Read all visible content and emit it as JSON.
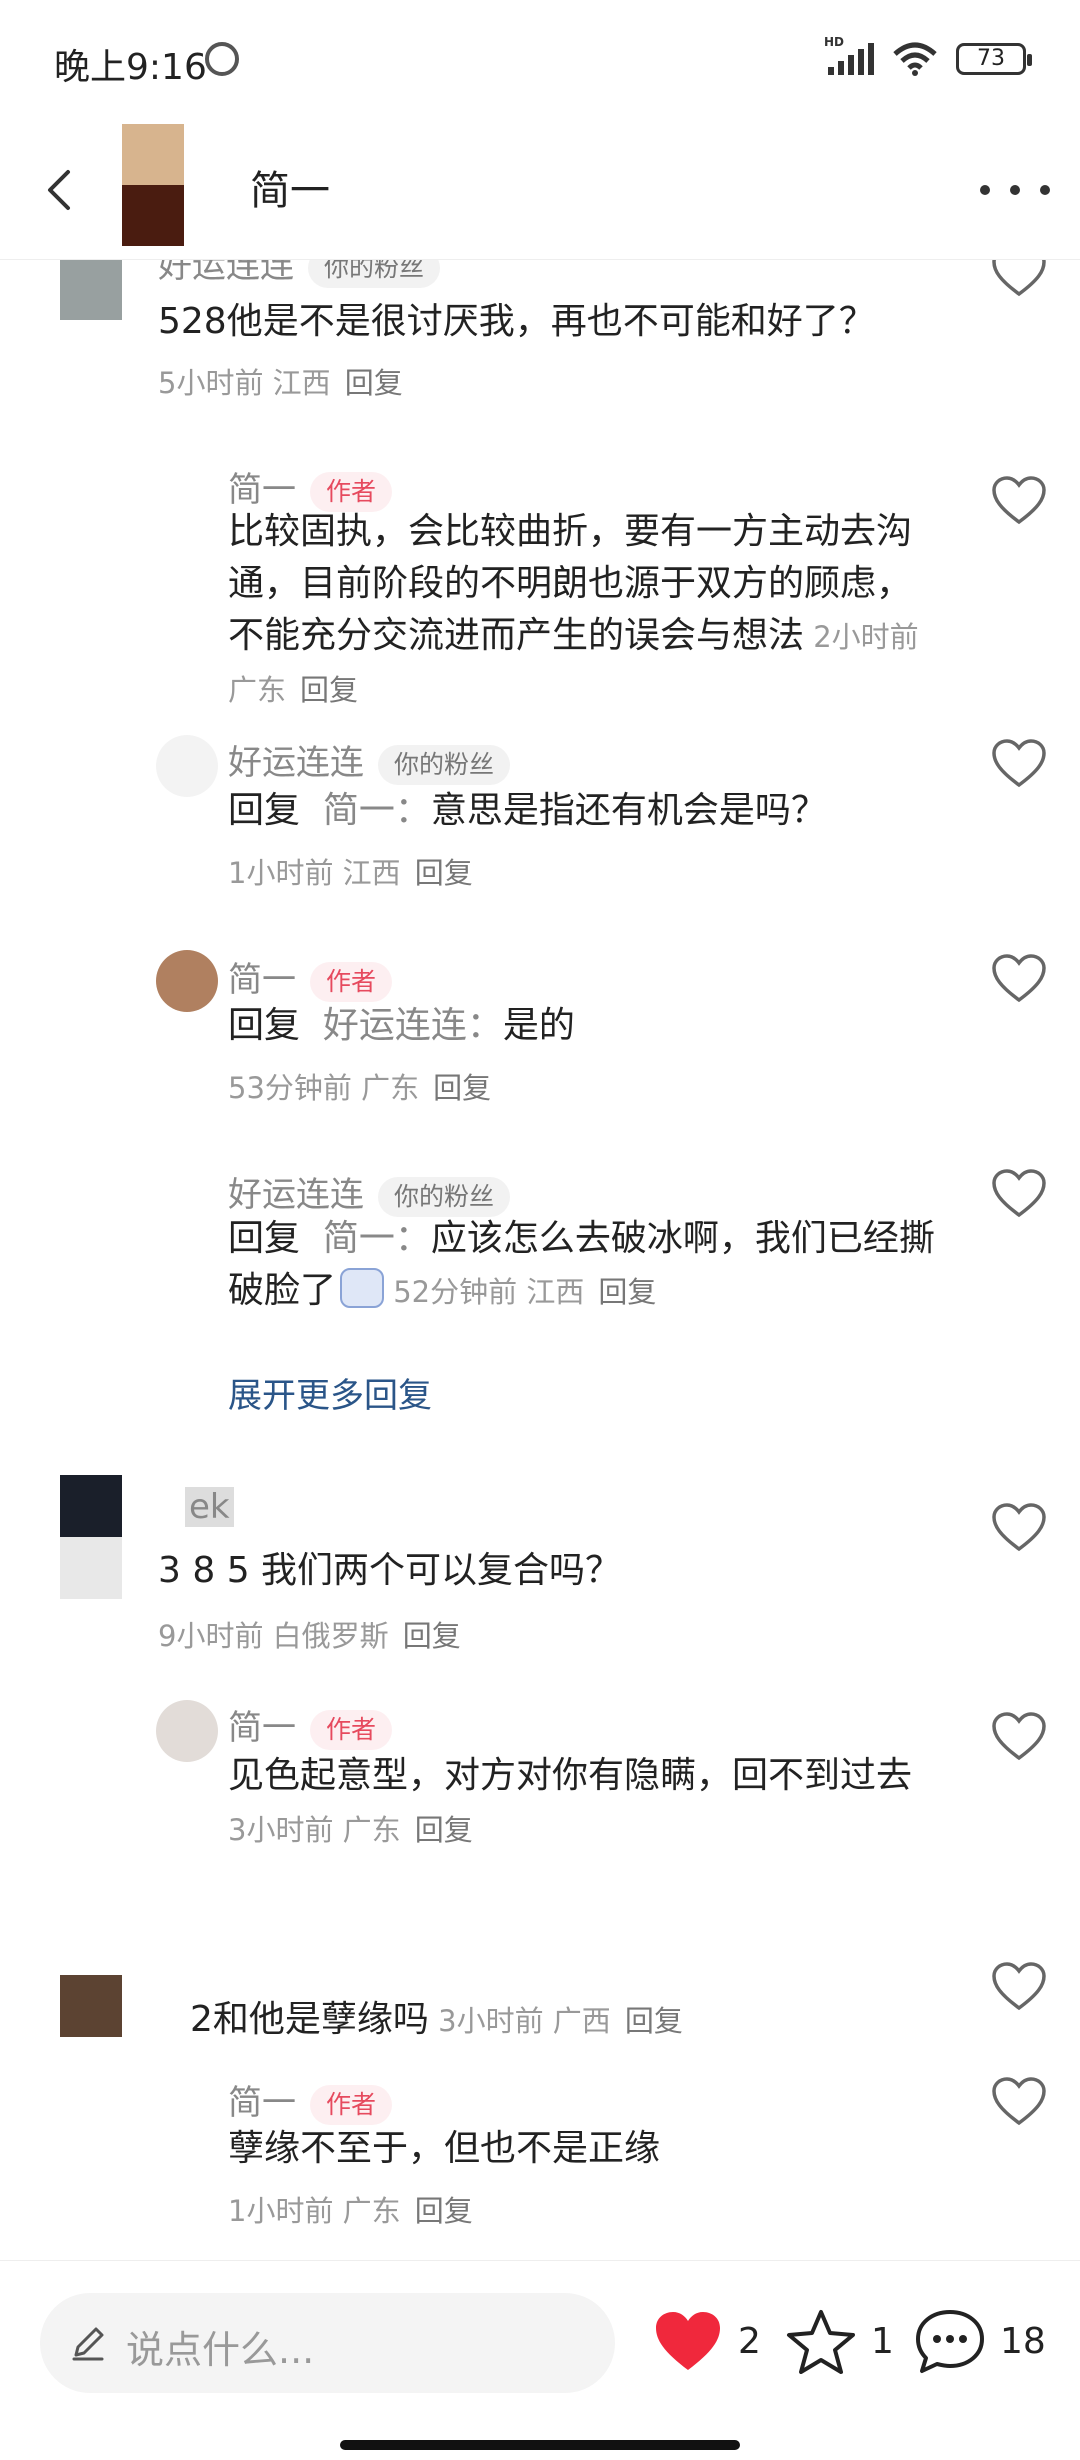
{
  "status": {
    "time": "晚上9:16",
    "battery": "73",
    "network_label": "HD"
  },
  "header": {
    "title": "简一"
  },
  "comments": [
    {
      "name": "好运连连",
      "badge": "你的粉丝",
      "text": "528他是不是很讨厌我，再也不可能和好了？",
      "time": "5小时前",
      "location": "江西",
      "reply": "回复"
    },
    {
      "name": "简一",
      "badge": "作者",
      "text": "比较固执，会比较曲折，要有一方主动去沟通，目前阶段的不明朗也源于双方的顾虑，不能充分交流进而产生的误会与想法",
      "time": "2小时前",
      "location": "广东",
      "reply": "回复"
    },
    {
      "name": "好运连连",
      "badge": "你的粉丝",
      "prefix": "回复",
      "target": "简一：",
      "text": "意思是指还有机会是吗？",
      "time": "1小时前",
      "location": "江西",
      "reply": "回复"
    },
    {
      "name": "简一",
      "badge": "作者",
      "prefix": "回复",
      "target": "好运连连：",
      "text": "是的",
      "time": "53分钟前",
      "location": "广东",
      "reply": "回复"
    },
    {
      "name": "好运连连",
      "badge": "你的粉丝",
      "prefix": "回复",
      "target": "简一：",
      "text": "应该怎么去破冰啊，我们已经撕破脸了",
      "time": "52分钟前",
      "location": "江西",
      "reply": "回复"
    },
    {
      "name": "ek",
      "text": "3 8 5 我们两个可以复合吗？",
      "time": "9小时前",
      "location": "白俄罗斯",
      "reply": "回复"
    },
    {
      "name": "简一",
      "badge": "作者",
      "text": "见色起意型，对方对你有隐瞒，回不到过去",
      "time": "3小时前",
      "location": "广东",
      "reply": "回复"
    },
    {
      "text": "2和他是孽缘吗",
      "time": "3小时前",
      "location": "广西",
      "reply": "回复"
    },
    {
      "name": "简一",
      "badge": "作者",
      "text": "孽缘不至于，但也不是正缘",
      "time": "1小时前",
      "location": "广东",
      "reply": "回复"
    }
  ],
  "expand_replies": "展开更多回复",
  "bottom": {
    "placeholder": "说点什么...",
    "likes": "2",
    "favorites": "1",
    "comments": "18"
  },
  "colors": {
    "heart_red": "#f0283c",
    "author_badge": "#e64a5e",
    "expand_link": "#2a5588"
  },
  "icons": [
    "back-arrow-icon",
    "more-icon",
    "heart-outline-icon",
    "pencil-icon",
    "heart-filled-icon",
    "star-icon",
    "comment-bubble-icon"
  ]
}
